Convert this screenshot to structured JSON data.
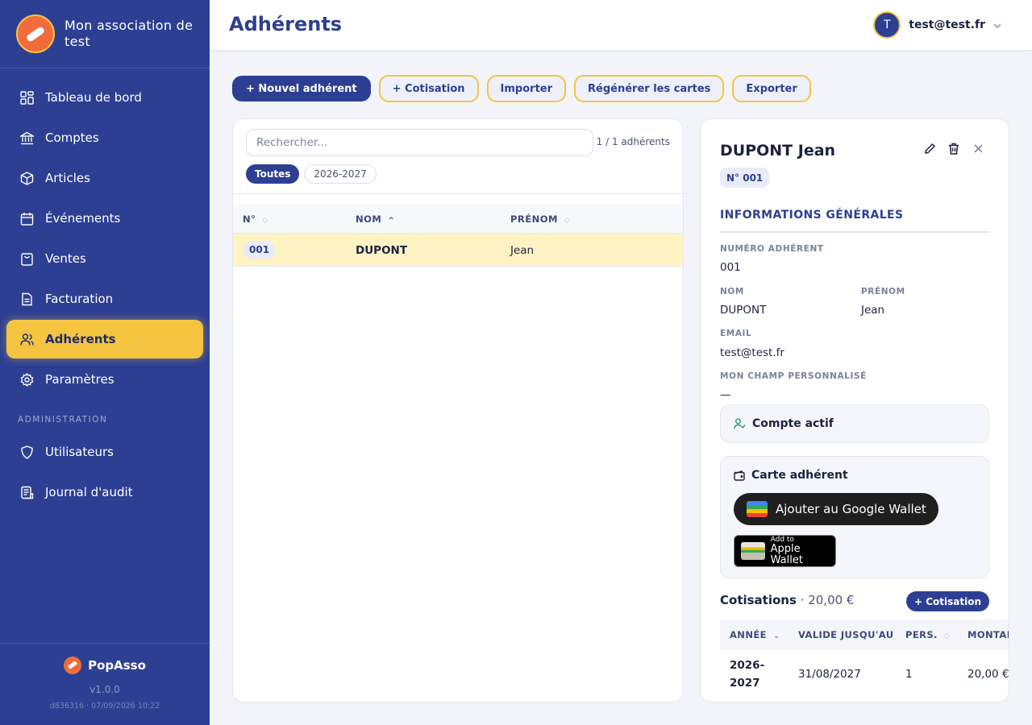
{
  "app": {
    "name": "Mon association de test",
    "footer_brand": "PopAsso",
    "version": "v1.0.0",
    "build": "d836316 · 07/09/2026 10:22"
  },
  "sidebar": {
    "items": [
      {
        "label": "Tableau de bord",
        "icon": "dashboard-icon"
      },
      {
        "label": "Comptes",
        "icon": "bank-icon"
      },
      {
        "label": "Articles",
        "icon": "box-icon"
      },
      {
        "label": "Événements",
        "icon": "calendar-icon"
      },
      {
        "label": "Ventes",
        "icon": "shopping-bag-icon"
      },
      {
        "label": "Facturation",
        "icon": "document-icon"
      },
      {
        "label": "Adhérents",
        "icon": "users-icon",
        "active": true
      },
      {
        "label": "Paramètres",
        "icon": "gear-icon"
      }
    ],
    "admin_section": "ADMINISTRATION",
    "admin_items": [
      {
        "label": "Utilisateurs",
        "icon": "shield-icon"
      },
      {
        "label": "Journal d'audit",
        "icon": "scroll-icon"
      }
    ]
  },
  "header": {
    "title": "Adhérents",
    "user_initial": "T",
    "user_email": "test@test.fr"
  },
  "toolbar": {
    "new_member": "+ Nouvel adhérent",
    "contribution": "+ Cotisation",
    "import": "Importer",
    "regenerate": "Régénérer les cartes",
    "export": "Exporter"
  },
  "list": {
    "search_placeholder": "Rechercher...",
    "count": "1 / 1 adhérents",
    "filters": [
      "Toutes",
      "2026-2027"
    ],
    "columns": [
      "N°",
      "NOM",
      "PRÉNOM"
    ],
    "rows": [
      {
        "num": "001",
        "nom": "DUPONT",
        "prenom": "Jean"
      }
    ]
  },
  "detail": {
    "name": "DUPONT Jean",
    "number_badge": "N° 001",
    "section_title": "INFORMATIONS GÉNÉRALES",
    "fields": {
      "numero_label": "NUMÉRO ADHÉRENT",
      "numero": "001",
      "nom_label": "NOM",
      "nom": "DUPONT",
      "prenom_label": "PRÉNOM",
      "prenom": "Jean",
      "email_label": "EMAIL",
      "email": "test@test.fr",
      "custom_label": "MON CHAMP PERSONNALISÉ",
      "custom": "—"
    },
    "account_status": "Compte actif",
    "card_title": "Carte adhérent",
    "google_wallet": "Ajouter au Google Wallet",
    "apple_small": "Add to",
    "apple_big": "Apple Wallet",
    "cotisations_label": "Cotisations",
    "cotisations_total": "· 20,00 €",
    "add_cotisation": "+ Cotisation",
    "cot_columns": [
      "ANNÉE",
      "VALIDE JUSQU'AU",
      "PERS.",
      "MONTANT"
    ],
    "cot_rows": [
      {
        "annee_1": "2026-",
        "annee_2": "2027",
        "valide": "31/08/2027",
        "pers": "1",
        "montant": "20,00 €"
      }
    ]
  },
  "colors": {
    "primary": "#2d3f92",
    "accent": "#f5c542",
    "highlight_row": "#fff3c4",
    "brand_orange": "#f26b3a"
  }
}
